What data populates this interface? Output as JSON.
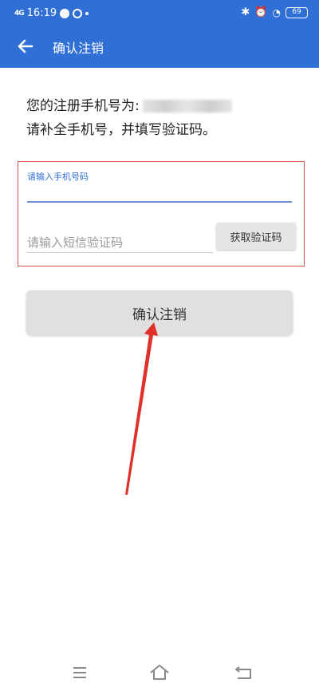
{
  "status_bar": {
    "signal": "4G",
    "time": "16:19",
    "battery": "69"
  },
  "header": {
    "back_icon": "arrow-left-icon",
    "title": "确认注销"
  },
  "info": {
    "line1": "您的注册手机号为:",
    "line2": "请补全手机号，并填写验证码。"
  },
  "form": {
    "phone_label": "请输入手机号码",
    "phone_value": "",
    "code_placeholder": "请输入短信验证码",
    "code_value": "",
    "get_code_label": "获取验证码"
  },
  "confirm_label": "确认注销",
  "nav": {
    "menu_icon": "menu-icon",
    "home_icon": "home-icon",
    "back_icon": "back-icon"
  },
  "colors": {
    "brand": "#2f6fd6",
    "highlight_border": "#d8554f",
    "annotation_arrow": "#e0302a",
    "button_bg": "#e0e0e0"
  }
}
